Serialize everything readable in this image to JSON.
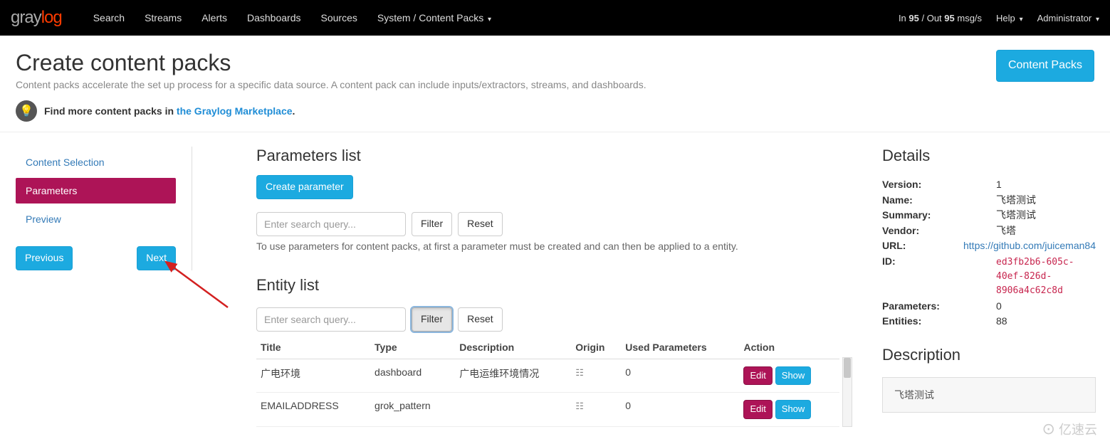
{
  "nav": {
    "logo": {
      "gray": "gray",
      "accent": "log"
    },
    "items": [
      "Search",
      "Streams",
      "Alerts",
      "Dashboards",
      "Sources",
      "System / Content Packs"
    ],
    "throughput_prefix": "In ",
    "throughput_in": "95",
    "throughput_mid": " / Out ",
    "throughput_out": "95",
    "throughput_suffix": " msg/s",
    "help": "Help",
    "admin": "Administrator"
  },
  "header": {
    "title": "Create content packs",
    "subtitle": "Content packs accelerate the set up process for a specific data source. A content pack can include inputs/extractors, streams, and dashboards.",
    "tip_prefix": "Find more content packs in ",
    "tip_link": "the Graylog Marketplace",
    "tip_suffix": ".",
    "content_packs_btn": "Content Packs"
  },
  "steps": {
    "items": [
      "Content Selection",
      "Parameters",
      "Preview"
    ],
    "prev": "Previous",
    "next": "Next"
  },
  "params": {
    "title": "Parameters list",
    "create_btn": "Create parameter",
    "search_ph": "Enter search query...",
    "filter": "Filter",
    "reset": "Reset",
    "help": "To use parameters for content packs, at first a parameter must be created and can then be applied to a entity."
  },
  "entities": {
    "title": "Entity list",
    "search_ph": "Enter search query...",
    "filter": "Filter",
    "reset": "Reset",
    "columns": {
      "title": "Title",
      "type": "Type",
      "desc": "Description",
      "origin": "Origin",
      "used": "Used Parameters",
      "action": "Action"
    },
    "rows": [
      {
        "title": "广电环境",
        "type": "dashboard",
        "desc": "广电运维环境情况",
        "used": "0"
      },
      {
        "title": "EMAILADDRESS",
        "type": "grok_pattern",
        "desc": "",
        "used": "0"
      }
    ],
    "edit": "Edit",
    "show": "Show"
  },
  "details": {
    "title": "Details",
    "labels": {
      "version": "Version:",
      "name": "Name:",
      "summary": "Summary:",
      "vendor": "Vendor:",
      "url": "URL:",
      "id": "ID:",
      "parameters": "Parameters:",
      "entities": "Entities:"
    },
    "values": {
      "version": "1",
      "name": "飞塔测试",
      "summary": "飞塔测试",
      "vendor": "飞塔",
      "url": "https://github.com/juiceman84",
      "id": "ed3fb2b6-605c-40ef-826d-8906a4c62c8d",
      "parameters": "0",
      "entities": "88"
    },
    "desc_title": "Description",
    "desc_body": "飞塔测试"
  },
  "watermark": "亿速云"
}
